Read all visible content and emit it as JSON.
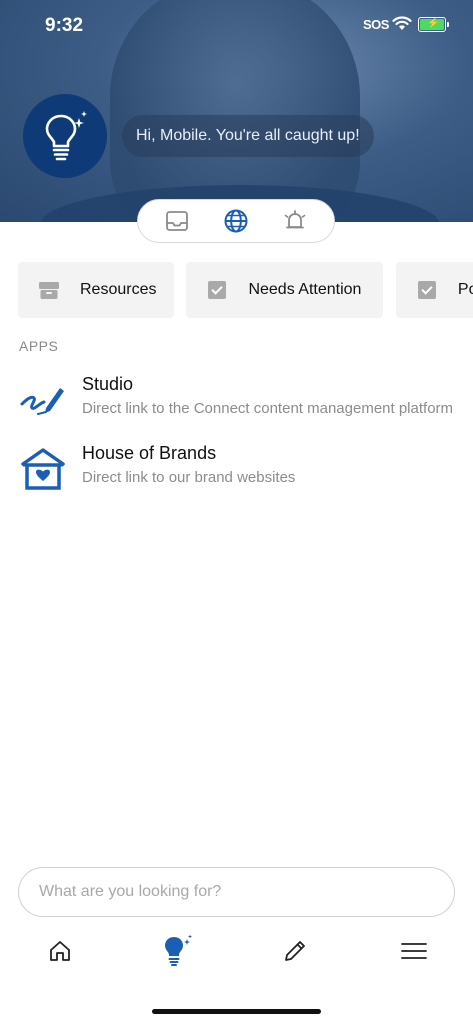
{
  "status": {
    "time": "9:32",
    "sos": "SOS"
  },
  "header": {
    "greeting": "Hi, Mobile. You're all caught up!"
  },
  "segments": [
    {
      "icon": "inbox-icon",
      "active": false
    },
    {
      "icon": "globe-icon",
      "active": true
    },
    {
      "icon": "bell-icon",
      "active": false
    }
  ],
  "chips": [
    {
      "label": "Resources",
      "icon": "archive-box-icon"
    },
    {
      "label": "Needs Attention",
      "icon": "checkbox-icon"
    },
    {
      "label": "Poll",
      "icon": "checkbox-icon"
    }
  ],
  "apps_section": {
    "label": "APPS"
  },
  "apps": [
    {
      "title": "Studio",
      "description": "Direct link to the Connect content management platform",
      "icon": "pen-signature-icon"
    },
    {
      "title": "House of Brands",
      "description": "Direct link to our brand websites",
      "icon": "house-heart-icon"
    }
  ],
  "search": {
    "placeholder": "What are you looking for?",
    "value": ""
  },
  "tabbar": [
    {
      "icon": "home-icon"
    },
    {
      "icon": "lightbulb-icon",
      "active": true
    },
    {
      "icon": "pencil-icon"
    },
    {
      "icon": "menu-icon"
    }
  ],
  "colors": {
    "brand": "#0e3b78",
    "accent": "#1a5fb4"
  }
}
